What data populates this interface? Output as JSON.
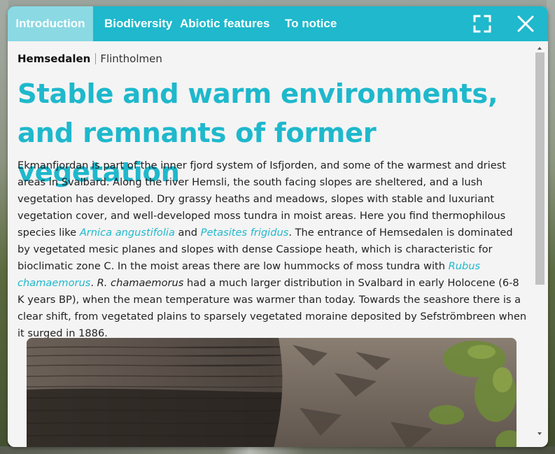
{
  "tabs": [
    {
      "label": "Introduction",
      "active": true
    },
    {
      "label": "Biodiversity",
      "active": false
    },
    {
      "label": "Abiotic features",
      "active": false
    },
    {
      "label": "To notice",
      "active": false
    }
  ],
  "toolbar": {
    "fullscreen_icon": "fullscreen-icon",
    "close_icon": "close-icon"
  },
  "breadcrumb": {
    "area": "Hemsedalen",
    "site": "Flintholmen"
  },
  "article": {
    "title": "Stable and warm environments, and remnants of former vegetation",
    "p1": "Ekmanfjordan is part of the inner fjord system of Isfjorden, and some of the warmest and driest areas in Svalbard. Along the river Hemsli, the south facing slopes are sheltered, and a lush vegetation has developed. Dry grassy heaths and meadows, slopes with stable and luxuriant vegetation cover, and well-developed moss tundra in moist areas. Here you find thermophilous species like ",
    "species1": "Arnica angustifolia",
    "and": " and ",
    "species2": "Petasites frigidus",
    "p2": ". The entrance of Hemsedalen is dominated by vegetated mesic planes and slopes with dense Cassiope heath, which is characteristic for bioclimatic zone C. In the moist areas there are low hummocks of moss tundra with ",
    "species3": "Rubus chamaemorus",
    "p3": ". ",
    "species3_abbrev": "R. chamaemorus",
    "p4": " had a much larger distribution in Svalbard in early Holocene (6-8 K years BP), when the mean temperature was warmer than today. Towards the seashore there is a clear shift, from vegetated plains to sparsely vegetated moraine deposited by Sefströmbreen when it surged in 1886."
  },
  "colors": {
    "accent": "#1fb8cc",
    "active_tab": "#8ad9e3",
    "panel_bg": "#f4f4f4",
    "text": "#222222"
  }
}
